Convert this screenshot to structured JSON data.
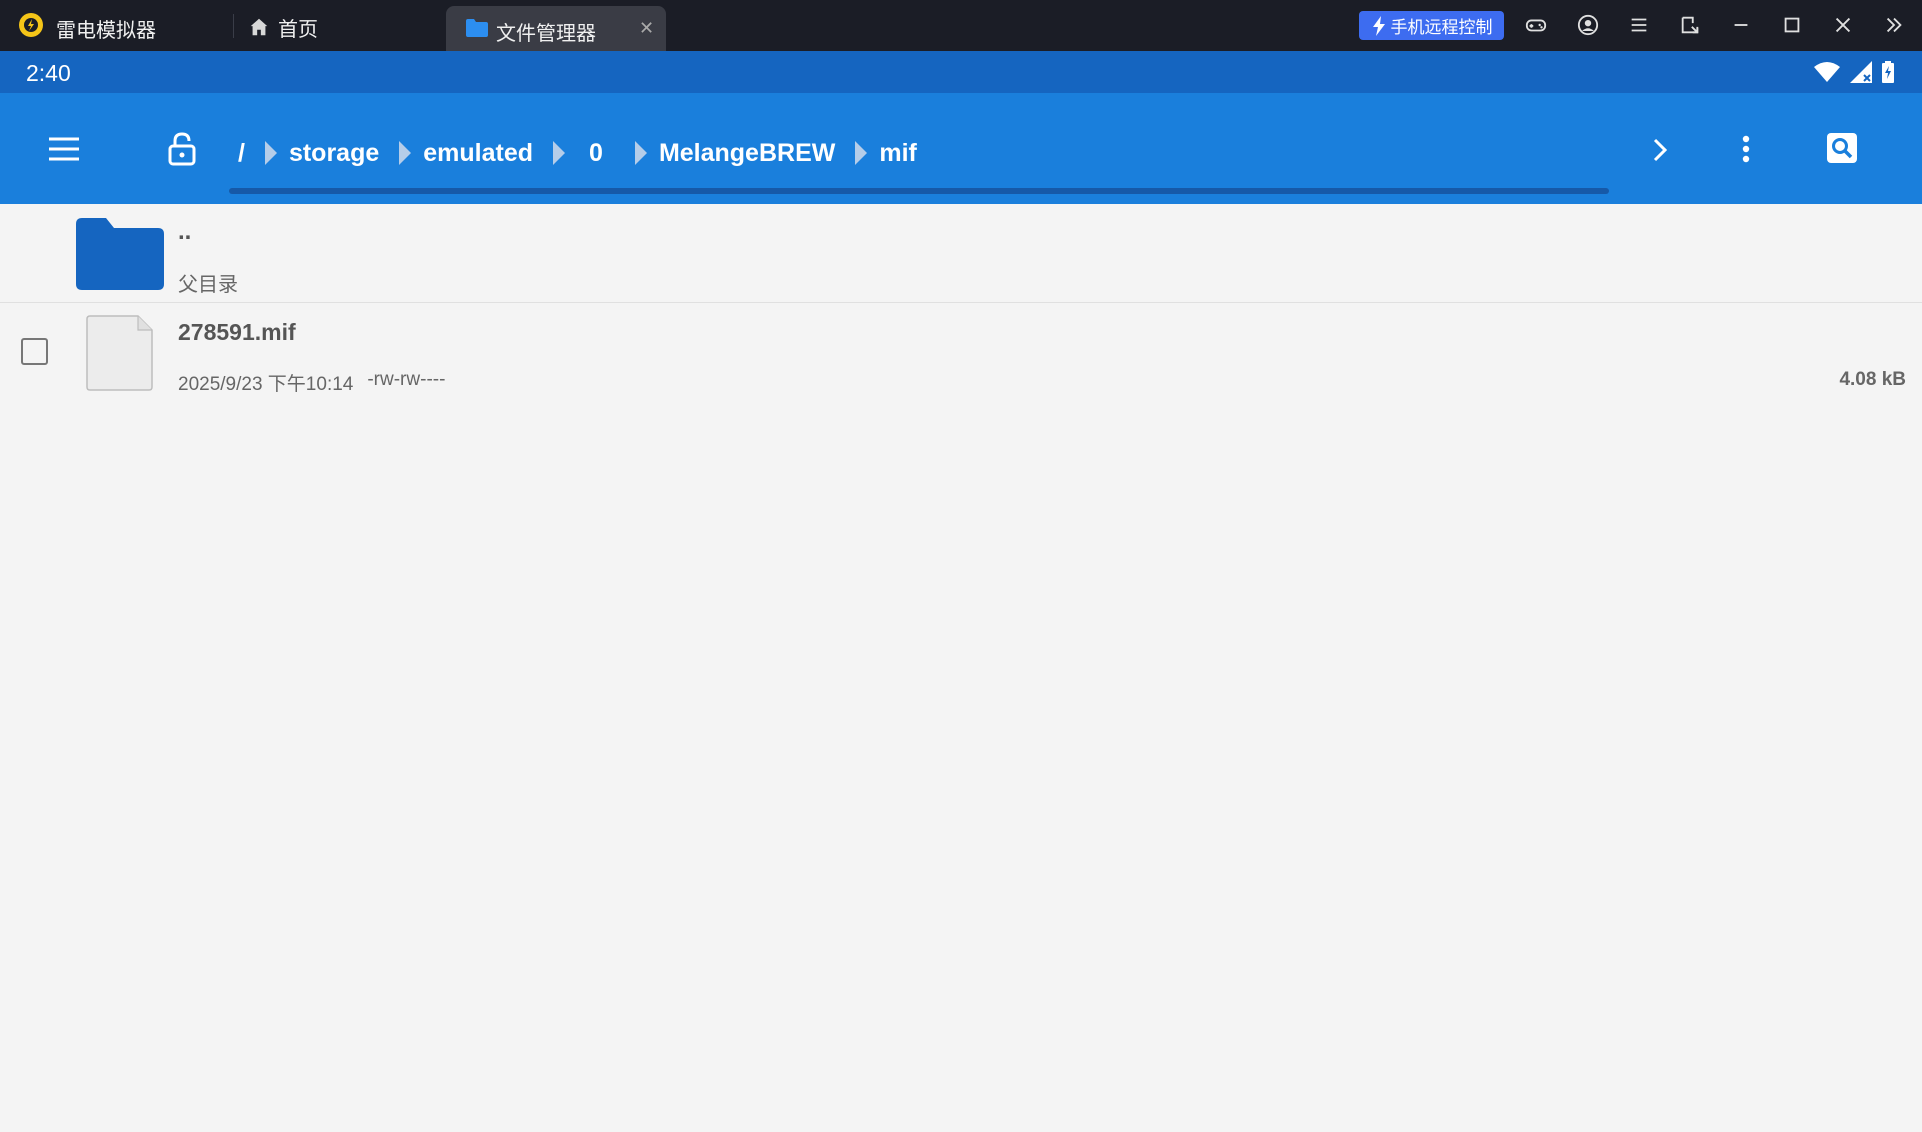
{
  "window": {
    "app_name": "雷电模拟器",
    "home_tab": "首页",
    "active_tab": "文件管理器",
    "remote_button": "手机远程控制"
  },
  "status": {
    "time": "2:40"
  },
  "toolbar": {
    "breadcrumbs": [
      "/",
      "storage",
      "emulated",
      "0",
      "MelangeBREW",
      "mif"
    ]
  },
  "list": {
    "parent": {
      "name": "..",
      "label": "父目录"
    },
    "files": [
      {
        "name": "278591.mif",
        "date": "2025/9/23 下午10:14",
        "permissions": "-rw-rw----",
        "size": "4.08 kB",
        "checked": false
      }
    ]
  },
  "colors": {
    "titlebar": "#1b1d26",
    "statusbar": "#1565c0",
    "toolbar": "#1a7fdc",
    "folder": "#1565c0",
    "remote_button": "#3d6cf0"
  }
}
